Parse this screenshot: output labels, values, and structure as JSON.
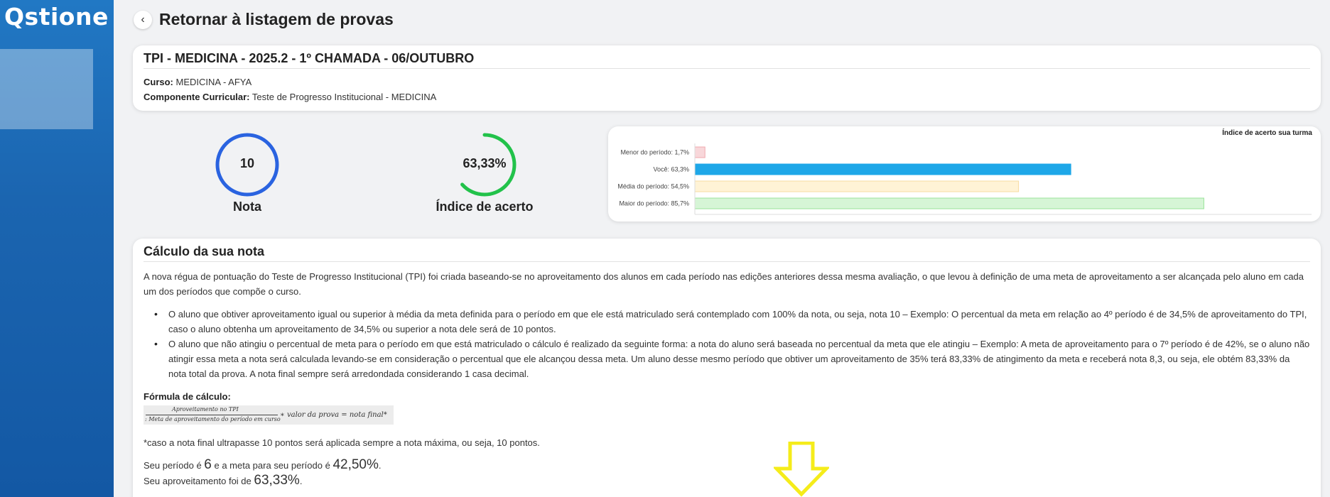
{
  "sidebar": {
    "logo": "Qstione"
  },
  "header": {
    "back_label": "Retornar à listagem de provas"
  },
  "exam": {
    "title": "TPI - MEDICINA - 2025.2 - 1º CHAMADA - 06/OUTUBRO",
    "course_label": "Curso:",
    "course_value": " MEDICINA - AFYA",
    "component_label": "Componente Curricular:",
    "component_value": " Teste de Progresso Institucional - MEDICINA"
  },
  "metrics": {
    "nota_value": "10",
    "nota_label": "Nota",
    "nota_fraction": 1.0,
    "indice_value": "63,33%",
    "indice_label": "Índice de acerto",
    "indice_fraction": 0.6333
  },
  "chart_data": {
    "type": "bar",
    "orientation": "horizontal",
    "title": "Índice de acerto sua turma",
    "categories": [
      "Menor do período: 1,7%",
      "Você: 63,3%",
      "Média do período: 54,5%",
      "Maior do período: 85,7%"
    ],
    "values": [
      1.7,
      63.3,
      54.5,
      85.7
    ],
    "colors": [
      "#f8d7da",
      "#1ea7e8",
      "#fff3d6",
      "#d6f5d6"
    ],
    "border_colors": [
      "#f0a8ae",
      "#1ea7e8",
      "#f7dca0",
      "#9be39b"
    ],
    "xlim": [
      0,
      100
    ],
    "grid": false
  },
  "calc": {
    "title": "Cálculo da sua nota",
    "intro": "A nova régua de pontuação do Teste de Progresso Institucional (TPI) foi criada baseando-se no aproveitamento dos alunos em cada período nas edições anteriores dessa mesma avaliação, o que levou à definição de uma meta de aproveitamento a ser alcançada pelo aluno em cada um dos períodos que compõe o curso.",
    "bullets": [
      "O aluno que obtiver aproveitamento igual ou superior à média da meta definida para o período em que ele está matriculado será contemplado com 100% da nota, ou seja, nota 10 – Exemplo: O percentual da meta em relação ao 4º período é de 34,5% de aproveitamento do TPI, caso o aluno obtenha um aproveitamento de 34,5% ou superior a nota dele será de 10 pontos.",
      "O aluno que não atingiu o percentual de meta para o período em que está matriculado o cálculo é realizado da seguinte forma: a nota do aluno será baseada no percentual da meta que ele atingiu – Exemplo: A meta de aproveitamento para o 7º período é de 42%, se o aluno não atingir essa meta a nota será calculada levando-se em consideração o percentual que ele alcançou dessa meta. Um aluno desse mesmo período que obtiver um aproveitamento de 35% terá 83,33% de atingimento da meta e receberá nota 8,3, ou seja, ele obtém 83,33% da nota total da prova. A nota final sempre será arredondada considerando 1 casa decimal."
    ],
    "formula_label": "Fórmula de cálculo:",
    "formula_numerator": "Aproveitamento no TPI",
    "formula_denominator": ": Meta de aproveitamento do período em curso",
    "formula_rest": "∗ valor da prova = nota final*",
    "note": "*caso a nota final ultrapasse 10 pontos será aplicada sempre a nota máxima, ou seja, 10 pontos.",
    "period_prefix": "Seu período é ",
    "period_value": "6",
    "goal_prefix": " e a meta para seu período é ",
    "goal_value": "42,50%",
    "goal_suffix": ".",
    "perf_prefix": "Seu aproveitamento foi de ",
    "perf_value": "63,33%",
    "perf_suffix": "."
  },
  "colors": {
    "nota_ring": "#2a63e0",
    "indice_ring": "#22c24a",
    "arrow": "#f5ec1a"
  }
}
